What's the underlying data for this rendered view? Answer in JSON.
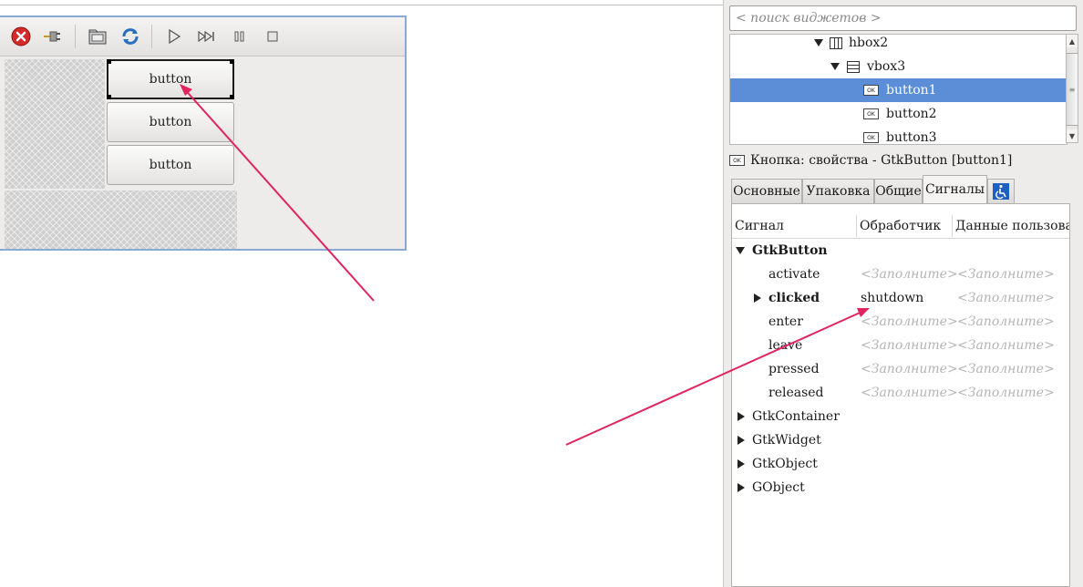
{
  "design_window": {
    "toolbar_icons": [
      "close-icon",
      "plug-icon",
      "folder-icon",
      "refresh-icon",
      "play-icon",
      "skip-forward-icon",
      "pause-icon",
      "stop-icon"
    ],
    "buttons": [
      {
        "label": "button",
        "selected": true
      },
      {
        "label": "button",
        "selected": false
      },
      {
        "label": "button",
        "selected": false
      }
    ]
  },
  "search": {
    "placeholder": "< поиск виджетов >"
  },
  "tree": {
    "items": [
      {
        "label": "hbox2",
        "icon": "hbox-icon",
        "expanded": true
      },
      {
        "label": "vbox3",
        "icon": "vbox-icon",
        "expanded": true
      },
      {
        "label": "button1",
        "icon": "ok-button-icon",
        "selected": true
      },
      {
        "label": "button2",
        "icon": "ok-button-icon"
      },
      {
        "label": "button3",
        "icon": "ok-button-icon"
      }
    ]
  },
  "properties": {
    "title": "Кнопка: свойства - GtkButton [button1]",
    "ok_icon_text": "OK"
  },
  "tabs": [
    {
      "label": "Основные"
    },
    {
      "label": "Упаковка"
    },
    {
      "label": "Общие"
    },
    {
      "label": "Сигналы",
      "active": true
    },
    {
      "icon": "accessibility-icon"
    }
  ],
  "signals": {
    "columns": [
      "Сигнал",
      "Обработчик",
      "Данные пользовате"
    ],
    "group": "GtkButton",
    "placeholder": "<Заполните>",
    "rows": [
      {
        "signal": "activate",
        "handler": "",
        "bold": false
      },
      {
        "signal": "clicked",
        "handler": "shutdown",
        "bold": true
      },
      {
        "signal": "enter",
        "handler": "",
        "bold": false
      },
      {
        "signal": "leave",
        "handler": "",
        "bold": false
      },
      {
        "signal": "pressed",
        "handler": "",
        "bold": false
      },
      {
        "signal": "released",
        "handler": "",
        "bold": false
      }
    ],
    "collapsed_groups": [
      "GtkContainer",
      "GtkWidget",
      "GtkObject",
      "GObject"
    ]
  },
  "colors": {
    "selection": "#5b8ed6",
    "arrow": "#e0245e",
    "window_border": "#8aaad6"
  }
}
